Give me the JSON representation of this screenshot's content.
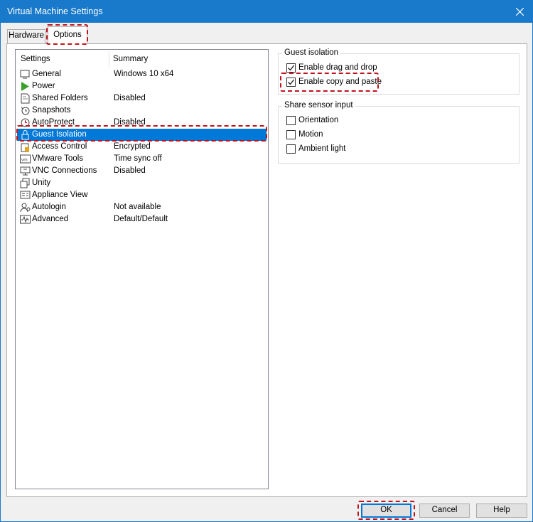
{
  "window": {
    "title": "Virtual Machine Settings"
  },
  "tabs": [
    {
      "label": "Hardware"
    },
    {
      "label": "Options"
    }
  ],
  "settings_list": {
    "headers": {
      "settings": "Settings",
      "summary": "Summary"
    },
    "items": [
      {
        "label": "General",
        "summary": "Windows 10 x64",
        "icon": "monitor-icon"
      },
      {
        "label": "Power",
        "summary": "",
        "icon": "play-icon"
      },
      {
        "label": "Shared Folders",
        "summary": "Disabled",
        "icon": "folder-icon"
      },
      {
        "label": "Snapshots",
        "summary": "",
        "icon": "camera-icon"
      },
      {
        "label": "AutoProtect",
        "summary": "Disabled",
        "icon": "clock-icon"
      },
      {
        "label": "Guest Isolation",
        "summary": "",
        "icon": "lock-icon",
        "selected": true
      },
      {
        "label": "Access Control",
        "summary": "Encrypted",
        "icon": "padlock-icon"
      },
      {
        "label": "VMware Tools",
        "summary": "Time sync off",
        "icon": "vm-icon"
      },
      {
        "label": "VNC Connections",
        "summary": "Disabled",
        "icon": "network-icon"
      },
      {
        "label": "Unity",
        "summary": "",
        "icon": "windows-icon"
      },
      {
        "label": "Appliance View",
        "summary": "",
        "icon": "appliance-icon"
      },
      {
        "label": "Autologin",
        "summary": "Not available",
        "icon": "user-icon"
      },
      {
        "label": "Advanced",
        "summary": "Default/Default",
        "icon": "waveform-icon"
      }
    ]
  },
  "guest_isolation": {
    "title": "Guest isolation",
    "options": [
      {
        "label": "Enable drag and drop",
        "checked": true
      },
      {
        "label": "Enable copy and paste",
        "checked": true
      }
    ]
  },
  "share_sensor_input": {
    "title": "Share sensor input",
    "options": [
      {
        "label": "Orientation",
        "checked": false
      },
      {
        "label": "Motion",
        "checked": false
      },
      {
        "label": "Ambient light",
        "checked": false
      }
    ]
  },
  "buttons": {
    "ok": "OK",
    "cancel": "Cancel",
    "help": "Help"
  },
  "colors": {
    "titlebar": "#1979ca",
    "selection": "#0078d7",
    "highlight": "#c0141d"
  }
}
